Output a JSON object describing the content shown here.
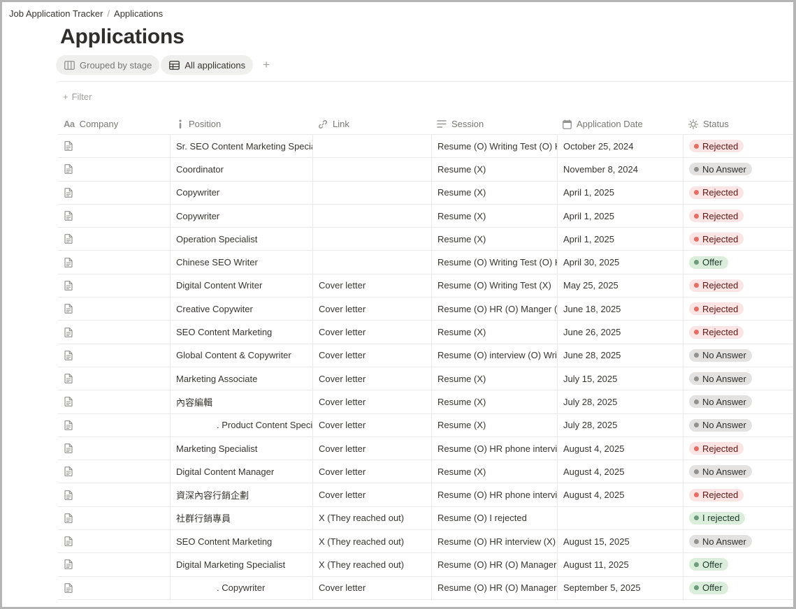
{
  "breadcrumb": {
    "workspace": "Job Application Tracker",
    "sep": "/",
    "page": "Applications"
  },
  "page_title": "Applications",
  "views": [
    {
      "label": "Grouped by stage",
      "icon": "board-icon",
      "active": false
    },
    {
      "label": "All applications",
      "icon": "table-icon",
      "active": true
    }
  ],
  "add_view_label": "+",
  "filter_label": "Filter",
  "columns": {
    "company": "Company",
    "position": "Position",
    "link": "Link",
    "session": "Session",
    "date": "Application Date",
    "status": "Status"
  },
  "status_colors": {
    "red": "#e16f64",
    "gray": "#91918e",
    "green": "#6c9b7d"
  },
  "rows": [
    {
      "position": "Sr. SEO Content Marketing Specialist",
      "link": "",
      "session": "Resume (O) Writing Test (O) HR",
      "date": "October 25, 2024",
      "status": "Rejected",
      "tone": "red"
    },
    {
      "position": "Coordinator",
      "link": "",
      "session": "Resume (X)",
      "date": "November 8, 2024",
      "status": "No Answer",
      "tone": "gray"
    },
    {
      "position": "Copywriter",
      "link": "",
      "session": "Resume (X)",
      "date": "April 1, 2025",
      "status": "Rejected",
      "tone": "red"
    },
    {
      "position": "Copywriter",
      "link": "",
      "session": "Resume (X)",
      "date": "April 1, 2025",
      "status": "Rejected",
      "tone": "red"
    },
    {
      "position": "Operation Specialist",
      "link": "",
      "session": "Resume (X)",
      "date": "April 1, 2025",
      "status": "Rejected",
      "tone": "red"
    },
    {
      "position": "Chinese SEO Writer",
      "link": "",
      "session": "Resume (O) Writing Test (O) HR",
      "date": "April 30, 2025",
      "status": "Offer",
      "tone": "green"
    },
    {
      "position": "Digital Content Writer",
      "link": "Cover letter",
      "session": "Resume (O) Writing Test (X)",
      "date": "May 25, 2025",
      "status": "Rejected",
      "tone": "red"
    },
    {
      "position": "Creative Copywiter",
      "link": "Cover letter",
      "session": "Resume (O) HR (O) Manger (X)",
      "date": "June 18, 2025",
      "status": "Rejected",
      "tone": "red"
    },
    {
      "position": "SEO Content Marketing",
      "link": "Cover letter",
      "session": "Resume (X)",
      "date": "June 26, 2025",
      "status": "Rejected",
      "tone": "red"
    },
    {
      "position": "Global Content & Copywriter",
      "link": "Cover letter",
      "session": "Resume (O) interview (O) Writing",
      "date": "June 28, 2025",
      "status": "No Answer",
      "tone": "gray"
    },
    {
      "position": "Marketing Associate",
      "link": "Cover letter",
      "session": "Resume (X)",
      "date": "July 15, 2025",
      "status": "No Answer",
      "tone": "gray"
    },
    {
      "position": "內容編輯",
      "link": "Cover letter",
      "session": "Resume (X)",
      "date": "July 28, 2025",
      "status": "No Answer",
      "tone": "gray"
    },
    {
      "position": ". Product Content Specialist",
      "link": "Cover letter",
      "session": "Resume (X)",
      "date": "July 28, 2025",
      "status": "No Answer",
      "tone": "gray",
      "indent": true
    },
    {
      "position": "Marketing Specialist",
      "link": "Cover letter",
      "session": "Resume (O) HR phone interview",
      "date": "August 4, 2025",
      "status": "Rejected",
      "tone": "red"
    },
    {
      "position": "Digital Content Manager",
      "link": "Cover letter",
      "session": "Resume (X)",
      "date": "August 4, 2025",
      "status": "No Answer",
      "tone": "gray"
    },
    {
      "position": "資深內容行銷企劃",
      "link": "Cover letter",
      "session": "Resume (O) HR phone interview",
      "date": "August 4, 2025",
      "status": "Rejected",
      "tone": "red"
    },
    {
      "position": "社群行銷專員",
      "link": "X (They reached out)",
      "session": "Resume (O) I rejected",
      "date": "",
      "status": "I rejected",
      "tone": "green"
    },
    {
      "position": "SEO Content Marketing",
      "link": "X (They reached out)",
      "session": "Resume (O) HR interview (X)",
      "date": "August 15, 2025",
      "status": "No Answer",
      "tone": "gray"
    },
    {
      "position": "Digital Marketing Specialist",
      "link": "X (They reached out)",
      "session": "Resume (O) HR (O) Manager (O)",
      "date": "August 11, 2025",
      "status": "Offer",
      "tone": "green"
    },
    {
      "position": ". Copywriter",
      "link": "Cover letter",
      "session": "Resume (O) HR (O) Manager (O)",
      "date": "September 5, 2025",
      "status": "Offer",
      "tone": "green",
      "indent": true
    }
  ]
}
